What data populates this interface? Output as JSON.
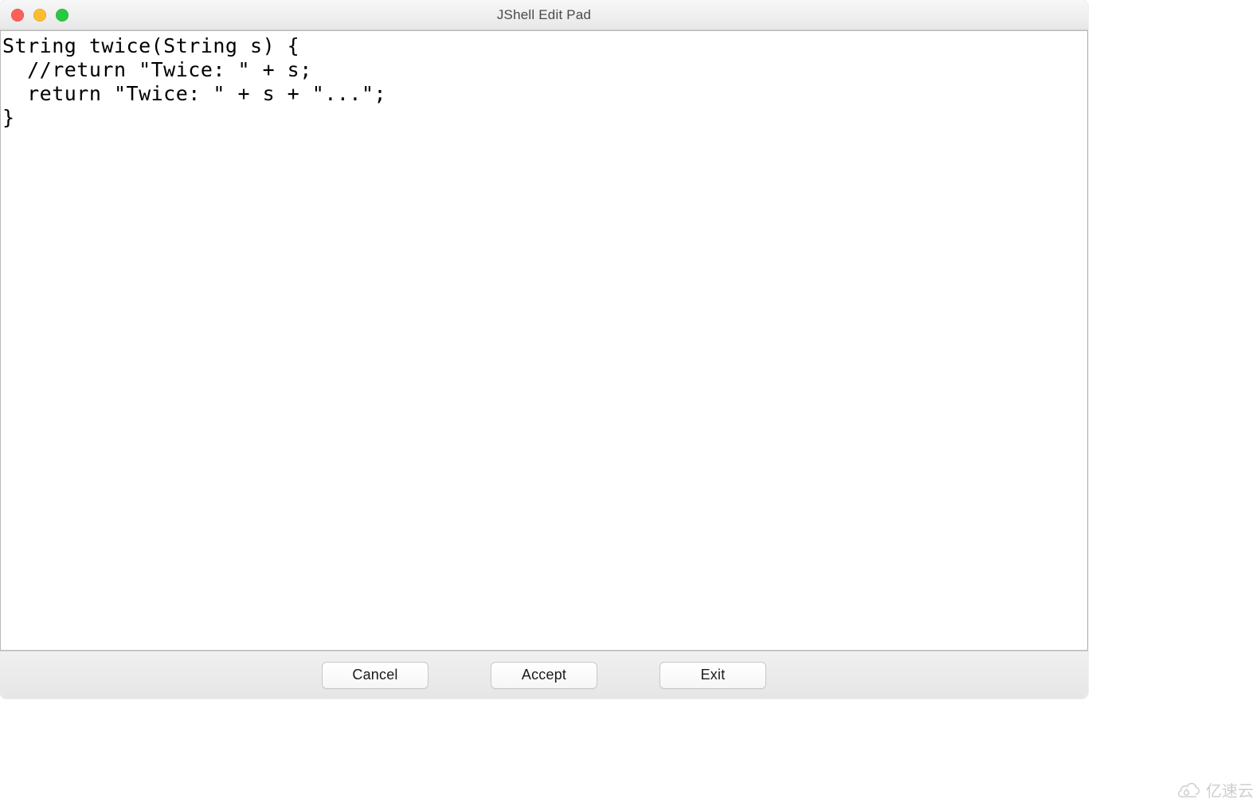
{
  "window": {
    "title": "JShell Edit Pad"
  },
  "editor": {
    "content": "String twice(String s) {\n  //return \"Twice: \" + s;\n  return \"Twice: \" + s + \"...\";\n}"
  },
  "buttons": {
    "cancel": "Cancel",
    "accept": "Accept",
    "exit": "Exit"
  },
  "watermark": {
    "text": "亿速云"
  }
}
